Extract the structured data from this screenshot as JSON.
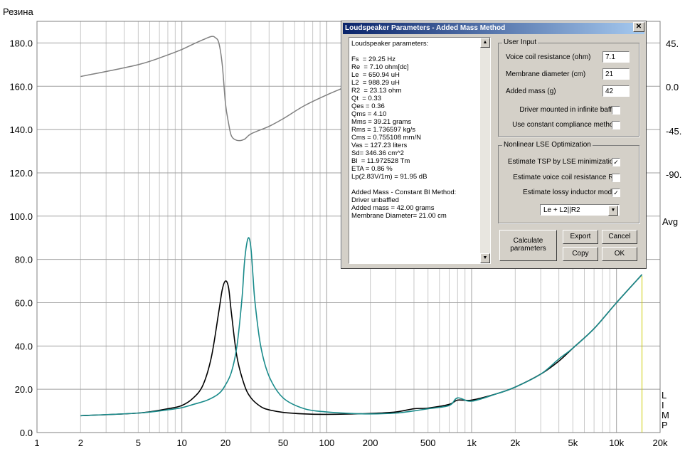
{
  "graph": {
    "title": "Резина",
    "y_ticks": [
      "180.0",
      "160.0",
      "140.0",
      "120.0",
      "100.0",
      "80.0",
      "60.0",
      "40.0",
      "20.0",
      "0.0"
    ],
    "x_ticks": [
      "1",
      "2",
      "5",
      "10",
      "20",
      "50",
      "100",
      "200",
      "500",
      "1k",
      "2k",
      "5k",
      "10k",
      "20k"
    ],
    "right_ticks": [
      "45.",
      "0.0",
      "-45.",
      "-90."
    ],
    "right_extra": "Avg",
    "limp_letters": [
      "L",
      "I",
      "M",
      "P"
    ],
    "colors": {
      "impedance_added_mass": "#000000",
      "impedance_free_air": "#1a8b8b",
      "phase": "#808080",
      "grid": "#c8c8c8",
      "marker": "#cccc00"
    }
  },
  "chart_data": {
    "type": "line",
    "title": "Резина",
    "xscale": "log",
    "xlim": [
      1,
      20000
    ],
    "ylim": [
      0,
      190
    ],
    "grid": true,
    "series": [
      {
        "name": "",
        "x": [
          2,
          5,
          8,
          10,
          12,
          14,
          16,
          18,
          19,
          20,
          21,
          22,
          24,
          27,
          30,
          35,
          40,
          50,
          70,
          100,
          200,
          300,
          400,
          500,
          700,
          800,
          1000,
          1500,
          2000,
          3000,
          4000,
          5000,
          7000,
          10000,
          15000
        ],
        "values": [
          7.8,
          9,
          11,
          12.5,
          16,
          22,
          35,
          56,
          66,
          70,
          67,
          55,
          35,
          22,
          16,
          12,
          10.5,
          9.3,
          8.6,
          8.4,
          8.8,
          9.5,
          11,
          11.3,
          13,
          15,
          15,
          18,
          21,
          27,
          33,
          39,
          48,
          60,
          73
        ]
      },
      {
        "name": "",
        "x": [
          2,
          5,
          8,
          10,
          12,
          15,
          18,
          20,
          22,
          24,
          26,
          27,
          28,
          29,
          30,
          31,
          32,
          35,
          40,
          50,
          70,
          100,
          150,
          200,
          300,
          400,
          500,
          700,
          800,
          1000,
          1500,
          2000,
          3000,
          4000,
          5000,
          7000,
          10000,
          15000
        ],
        "values": [
          7.8,
          9,
          10.5,
          11.5,
          13,
          15,
          18,
          22,
          28,
          40,
          62,
          78,
          87,
          90,
          85,
          72,
          60,
          40,
          26,
          16,
          11,
          9.5,
          8.8,
          8.6,
          9,
          10,
          11,
          12.5,
          16,
          14.5,
          18,
          21,
          27,
          34,
          39,
          48,
          60,
          73
        ]
      },
      {
        "name": "",
        "x": [
          2,
          5,
          8,
          10,
          12,
          14,
          16,
          17,
          18,
          19,
          20,
          21,
          22,
          24,
          27,
          30,
          40,
          50,
          70,
          100,
          150
        ],
        "values": [
          164.5,
          170,
          174.5,
          177,
          179.5,
          181.5,
          183,
          182.5,
          180,
          170,
          152,
          143,
          137,
          135,
          135.5,
          138,
          141.5,
          145,
          151,
          156,
          161
        ]
      }
    ]
  },
  "dialog": {
    "title": "Loudspeaker Parameters - Added Mass Method",
    "close_glyph": "✕",
    "results_lines": [
      "Loudspeaker parameters:",
      "",
      "Fs  = 29.25 Hz",
      "Re  = 7.10 ohm[dc]",
      "Le  = 650.94 uH",
      "L2  = 988.29 uH",
      "R2  = 23.13 ohm",
      "Qt  = 0.33",
      "Qes = 0.36",
      "Qms = 4.10",
      "Mms = 39.21 grams",
      "Rms = 1.736597 kg/s",
      "Cms = 0.755108 mm/N",
      "Vas = 127.23 liters",
      "Sd= 346.36 cm^2",
      "Bl  = 11.972528 Tm",
      "ETA = 0.86 %",
      "Lp(2.83V/1m) = 91.95 dB",
      "",
      "Added Mass - Constant Bl Method:",
      "Driver unbaffled",
      "Added mass = 42.00 grams",
      "Membrane Diameter= 21.00 cm"
    ],
    "user_input": {
      "title": "User Input",
      "voice_coil_label": "Voice coil resistance (ohm)",
      "voice_coil_value": "7.1",
      "membrane_label": "Membrane diameter (cm)",
      "membrane_value": "21",
      "added_mass_label": "Added mass (g)",
      "added_mass_value": "42",
      "infinite_baffle_label": "Driver mounted in infinite baffle",
      "infinite_baffle_checked": false,
      "constant_compliance_label": "Use constant compliance method",
      "constant_compliance_checked": false
    },
    "lse": {
      "title": "Nonlinear LSE Optimization",
      "tsp_label": "Estimate TSP by LSE minimization",
      "tsp_checked": true,
      "re_label": "Estimate voice coil resistance Re",
      "re_checked": false,
      "lossy_label": "Estimate lossy inductor model",
      "lossy_checked": true,
      "model_selected": "Le + L2||R2"
    },
    "buttons": {
      "calculate": "Calculate parameters",
      "export": "Export",
      "cancel": "Cancel",
      "copy": "Copy",
      "ok": "OK"
    }
  }
}
